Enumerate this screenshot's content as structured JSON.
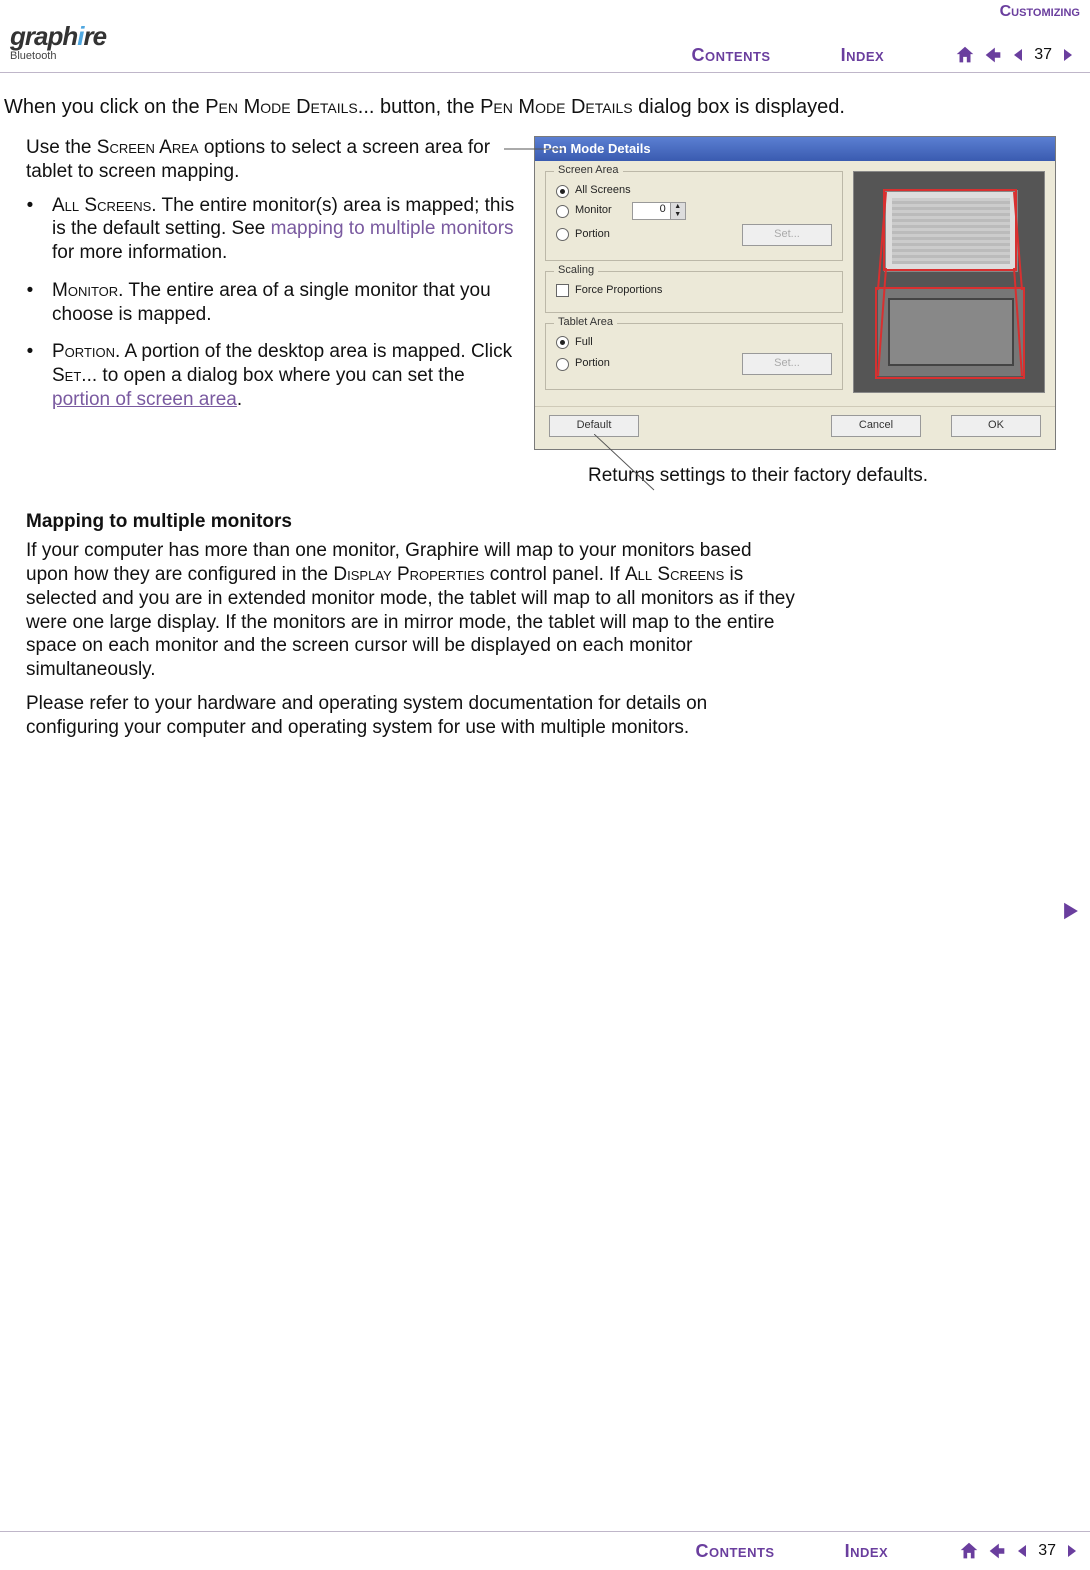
{
  "section_label": "Customizing",
  "nav": {
    "contents": "Contents",
    "index": "Index",
    "page": "37"
  },
  "logo": {
    "brand_left": "graph",
    "brand_dot": "i",
    "brand_right": "re",
    "subtitle": "Bluetooth"
  },
  "intro": {
    "pre": "When you click on the ",
    "cap1": "Pen Mode Details",
    "mid": "... button, the ",
    "cap2": "Pen Mode Details",
    "post": " dialog box is displayed."
  },
  "left": {
    "desc_pre": "Use the ",
    "desc_cap": "Screen Area",
    "desc_post": " options to select a screen area for tablet to screen mapping.",
    "items": [
      {
        "cap": "All Screens.",
        "text_a": "  The entire monitor(s) area is mapped; this is the default setting.  See ",
        "link": "mapping to multiple monitors",
        "text_b": " for more information."
      },
      {
        "cap": "Monitor.",
        "text_a": "  The entire area of a single monitor that you choose is mapped.",
        "link": "",
        "text_b": ""
      },
      {
        "cap": "Portion.",
        "text_a": "  A portion of the desktop area is mapped.  Click ",
        "cap2": "Set",
        "text_mid": "... to open a dialog box where you can set the ",
        "link": "portion of screen area",
        "text_b": "."
      }
    ]
  },
  "dialog": {
    "title": "Pen Mode Details",
    "group_screen": "Screen Area",
    "opt_all": "All Screens",
    "opt_monitor": "Monitor",
    "monitor_value": "0",
    "opt_portion": "Portion",
    "btn_set": "Set...",
    "group_scaling": "Scaling",
    "chk_force": "Force Proportions",
    "group_tablet": "Tablet Area",
    "opt_full": "Full",
    "opt_tportion": "Portion",
    "btn_default": "Default",
    "btn_cancel": "Cancel",
    "btn_ok": "OK"
  },
  "returns": "Returns settings to their factory defaults.",
  "subhead": "Mapping to multiple monitors",
  "para1": "If your computer has more than one monitor, Graphire will map to your monitors based upon how they are configured in the Display Properties control panel.  If All Screens is selected and you are in extended monitor mode, the tablet will map to all monitors as if they were one large display.  If the monitors are in mirror mode, the tablet will map to the entire space on each monitor and the screen cursor will be displayed on each monitor simultaneously.",
  "para1_seg": {
    "a": "If your computer has more than one monitor, Graphire will map to your monitors based upon how they are configured in the ",
    "cap1": "Display Properties",
    "b": " control panel.  If ",
    "cap2": "All Screens",
    "c": " is selected and you are in extended monitor mode, the tablet will map to all monitors as if they were one large display.  If the monitors are in mirror mode, the tablet will map to the entire space on each monitor and the screen cursor will be displayed on each monitor simultaneously."
  },
  "para2": "Please refer to your hardware and operating system documentation for details on configuring your computer and operating system for use with multiple monitors."
}
